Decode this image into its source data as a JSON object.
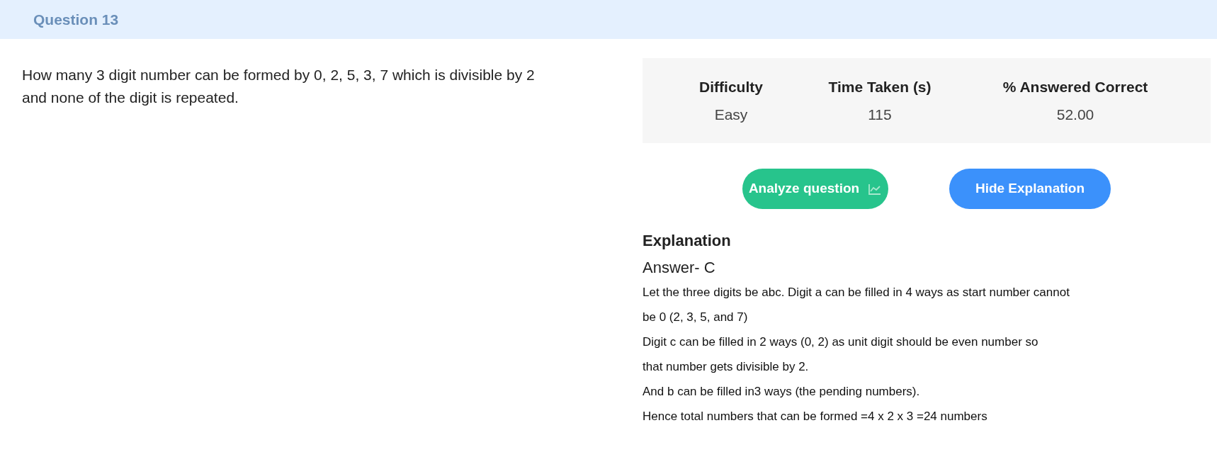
{
  "header": {
    "title": "Question 13"
  },
  "question": {
    "text": "How many 3 digit number can be formed by 0, 2, 5, 3, 7 which is divisible by 2 and none of the digit is repeated."
  },
  "stats": {
    "columns": [
      "Difficulty",
      "Time Taken (s)",
      "% Answered Correct"
    ],
    "values": [
      "Easy",
      "115",
      "52.00"
    ]
  },
  "buttons": [
    {
      "kind": "analyze",
      "label": "Analyze question"
    },
    {
      "kind": "toggle",
      "label": "Hide Explanation"
    }
  ],
  "explanation": {
    "heading": "Explanation",
    "answer": "Answer- C",
    "lines": [
      "Let the three digits be abc. Digit a can be filled in 4 ways as start number cannot",
      "be 0 (2, 3, 5, and 7)",
      "Digit c can be filled in 2 ways (0, 2) as unit digit should be even number so",
      "that number gets divisible by 2.",
      "And b can be filled in3 ways (the pending numbers).",
      "Hence total numbers that can be formed =4 x 2 x 3 =24 numbers"
    ]
  }
}
